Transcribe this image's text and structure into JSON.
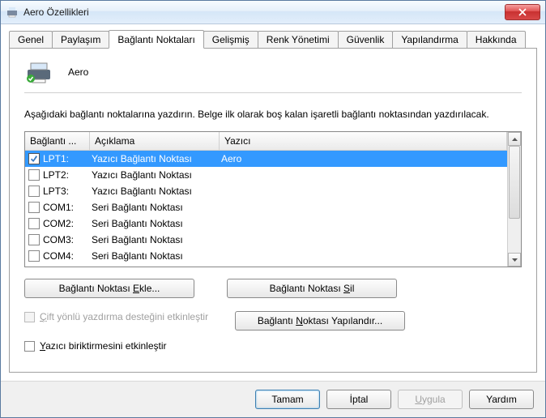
{
  "window": {
    "title": "Aero Özellikleri"
  },
  "tabs": [
    {
      "label": "Genel"
    },
    {
      "label": "Paylaşım"
    },
    {
      "label": "Bağlantı Noktaları",
      "active": true
    },
    {
      "label": "Gelişmiş"
    },
    {
      "label": "Renk Yönetimi"
    },
    {
      "label": "Güvenlik"
    },
    {
      "label": "Yapılandırma"
    },
    {
      "label": "Hakkında"
    }
  ],
  "device_name": "Aero",
  "description": "Aşağıdaki bağlantı noktalarına yazdırın. Belge ilk olarak boş kalan işaretli bağlantı noktasından yazdırılacak.",
  "columns": {
    "port": "Bağlantı ...",
    "desc": "Açıklama",
    "printer": "Yazıcı"
  },
  "ports": [
    {
      "checked": true,
      "selected": true,
      "port": "LPT1:",
      "desc": "Yazıcı Bağlantı Noktası",
      "printer": "Aero"
    },
    {
      "checked": false,
      "selected": false,
      "port": "LPT2:",
      "desc": "Yazıcı Bağlantı Noktası",
      "printer": ""
    },
    {
      "checked": false,
      "selected": false,
      "port": "LPT3:",
      "desc": "Yazıcı Bağlantı Noktası",
      "printer": ""
    },
    {
      "checked": false,
      "selected": false,
      "port": "COM1:",
      "desc": "Seri Bağlantı Noktası",
      "printer": ""
    },
    {
      "checked": false,
      "selected": false,
      "port": "COM2:",
      "desc": "Seri Bağlantı Noktası",
      "printer": ""
    },
    {
      "checked": false,
      "selected": false,
      "port": "COM3:",
      "desc": "Seri Bağlantı Noktası",
      "printer": ""
    },
    {
      "checked": false,
      "selected": false,
      "port": "COM4:",
      "desc": "Seri Bağlantı Noktası",
      "printer": ""
    }
  ],
  "buttons": {
    "add_port": {
      "pre": "Bağlantı Noktası ",
      "u": "E",
      "post": "kle..."
    },
    "delete_port": {
      "pre": "Bağlantı Noktası ",
      "u": "S",
      "post": "il"
    },
    "config_port": {
      "pre": "Bağlantı ",
      "u": "N",
      "post": "oktası Yapılandır..."
    }
  },
  "checkboxes": {
    "bidi": {
      "u": "Ç",
      "rest": "ift yönlü yazdırma desteğini etkinleştir",
      "disabled": true
    },
    "spool": {
      "u": "Y",
      "rest": "azıcı biriktirmesini etkinleştir",
      "disabled": false
    }
  },
  "footer": {
    "ok": "Tamam",
    "cancel": "İptal",
    "apply": {
      "u": "U",
      "rest": "ygula",
      "disabled": true
    },
    "help": "Yardım"
  }
}
